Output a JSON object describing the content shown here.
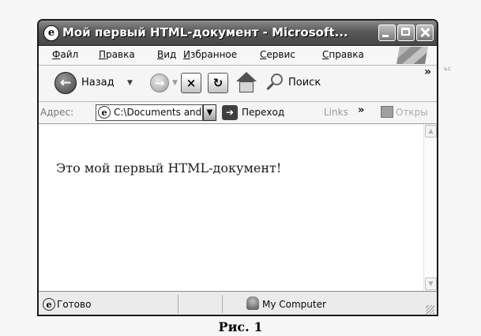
{
  "window": {
    "title": "Мой первый HTML-документ - Microsoft...",
    "page_icon_glyph": "e"
  },
  "menu": {
    "items": [
      "Файл",
      "Правка",
      "Вид",
      "Избранное",
      "Сервис",
      "Справка"
    ]
  },
  "toolbar": {
    "back_label": "Назад",
    "back_glyph": "←",
    "forward_glyph": "→",
    "stop_glyph": "×",
    "refresh_glyph": "↻",
    "search_label": "Поиск",
    "overflow_glyph": "»"
  },
  "address": {
    "label": "Адрес:",
    "value": "C:\\Documents and",
    "dropdown_glyph": "▼",
    "go_glyph": "➔",
    "go_label": "Переход",
    "links_label": "Links",
    "links_chevron": "»",
    "open_label": "Откры"
  },
  "content": {
    "text": "Это мой первый HTML-документ!"
  },
  "scrollbar": {
    "up_glyph": "▲",
    "down_glyph": "▼"
  },
  "status": {
    "text": "Готово",
    "zone": "My Computer"
  },
  "caption": "Рис. 1",
  "stray_text": "ьс"
}
